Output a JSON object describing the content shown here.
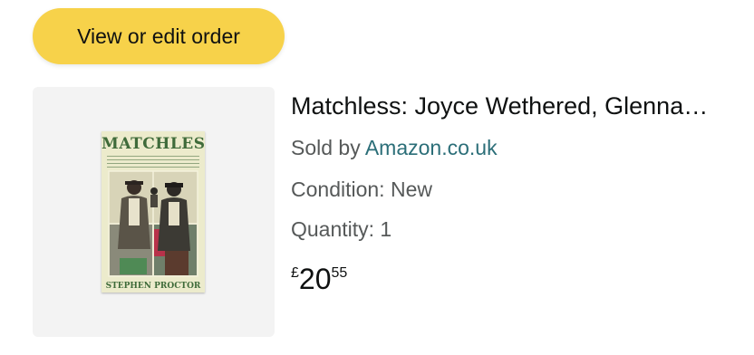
{
  "order": {
    "edit_button_label": "View or edit order"
  },
  "product": {
    "title": "Matchless: Joyce Wethered, Glenna…",
    "cover": {
      "title": "MATCHLESS",
      "author": "STEPHEN PROCTOR",
      "accent_color": "#3f6b3a"
    },
    "sold_by_label": "Sold by ",
    "seller_name": "Amazon.co.uk",
    "condition": "Condition: New",
    "quantity": "Quantity: 1",
    "price": {
      "currency_symbol": "£",
      "whole": "20",
      "fraction": "55"
    }
  },
  "colors": {
    "button_yellow": "#f7d24a",
    "link_teal": "#2b6e78",
    "secondary_text": "#565959"
  }
}
